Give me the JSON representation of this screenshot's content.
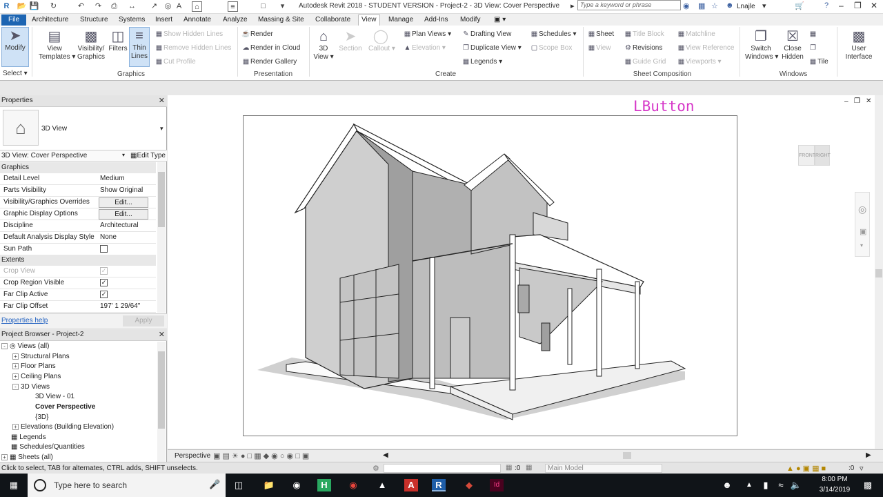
{
  "window": {
    "app_title": "Autodesk Revit 2018 -  STUDENT VERSION -    Project-2 - 3D View: Cover Perspective",
    "search_placeholder": "Type a keyword or phrase",
    "username": "Lnajle"
  },
  "menu_tabs": [
    "File",
    "Architecture",
    "Structure",
    "Systems",
    "Insert",
    "Annotate",
    "Analyze",
    "Massing & Site",
    "Collaborate",
    "View",
    "Manage",
    "Add-Ins",
    "Modify"
  ],
  "active_tab": "View",
  "ribbon": {
    "select": {
      "modify": "Modify",
      "select": "Select"
    },
    "graphics": {
      "label": "Graphics",
      "view_templates": [
        "View",
        "Templates"
      ],
      "visibility": [
        "Visibility/",
        "Graphics"
      ],
      "filters": "Filters",
      "thin_lines": [
        "Thin",
        "Lines"
      ],
      "show_hidden": "Show  Hidden Lines",
      "remove_hidden": "Remove  Hidden Lines",
      "cut_profile": "Cut  Profile"
    },
    "presentation": {
      "label": "Presentation",
      "render": "Render",
      "render_cloud": "Render  in Cloud",
      "render_gallery": "Render  Gallery"
    },
    "create": {
      "label": "Create",
      "view3d": [
        "3D",
        "View"
      ],
      "section": "Section",
      "callout": "Callout",
      "plan_views": "Plan  Views",
      "elevation": "Elevation",
      "drafting_view": "Drafting  View",
      "duplicate_view": "Duplicate  View",
      "legends": "Legends",
      "schedules": "Schedules",
      "scope_box": "Scope  Box"
    },
    "sheet_composition": {
      "label": "Sheet Composition",
      "sheet": "Sheet",
      "view": "View",
      "title_block": "Title  Block",
      "revisions": "Revisions",
      "guide_grid": "Guide  Grid",
      "matchline": "Matchline",
      "view_reference": "View  Reference",
      "viewports": "Viewports"
    },
    "windows": {
      "label": "Windows",
      "switch": [
        "Switch",
        "Windows"
      ],
      "close_hidden": [
        "Close",
        "Hidden"
      ],
      "tile": "Tile"
    },
    "user_interface": [
      "User",
      "Interface"
    ]
  },
  "properties": {
    "title": "Properties",
    "type_name": "3D View",
    "instance": "3D View: Cover Perspective",
    "edit_type": "Edit Type",
    "group_graphics": "Graphics",
    "group_extents": "Extents",
    "rows": [
      {
        "k": "Detail Level",
        "v": "Medium"
      },
      {
        "k": "Parts Visibility",
        "v": "Show Original"
      },
      {
        "k": "Visibility/Graphics Overrides",
        "v": "Edit..."
      },
      {
        "k": "Graphic Display Options",
        "v": "Edit..."
      },
      {
        "k": "Discipline",
        "v": "Architectural"
      },
      {
        "k": "Default Analysis Display Style",
        "v": "None"
      },
      {
        "k": "Sun Path",
        "v": ""
      },
      {
        "k": "Crop View",
        "v": ""
      },
      {
        "k": "Crop Region Visible",
        "v": ""
      },
      {
        "k": "Far Clip Active",
        "v": ""
      },
      {
        "k": "Far Clip Offset",
        "v": "197'  1 29/64\""
      }
    ],
    "help": "Properties help",
    "apply": "Apply"
  },
  "browser": {
    "title": "Project Browser - Project-2",
    "items": [
      {
        "label": "Views (all)",
        "level": 0,
        "pm": "-"
      },
      {
        "label": "Structural Plans",
        "level": 1,
        "pm": "+"
      },
      {
        "label": "Floor Plans",
        "level": 1,
        "pm": "+"
      },
      {
        "label": "Ceiling Plans",
        "level": 1,
        "pm": "+"
      },
      {
        "label": "3D Views",
        "level": 1,
        "pm": "-"
      },
      {
        "label": "3D View - 01",
        "level": 2,
        "pm": ""
      },
      {
        "label": "Cover Perspective",
        "level": 2,
        "pm": "",
        "bold": true
      },
      {
        "label": "{3D}",
        "level": 2,
        "pm": ""
      },
      {
        "label": "Elevations (Building Elevation)",
        "level": 1,
        "pm": "+"
      },
      {
        "label": "Legends",
        "level": 0,
        "pm": ""
      },
      {
        "label": "Schedules/Quantities",
        "level": 0,
        "pm": ""
      },
      {
        "label": "Sheets (all)",
        "level": 0,
        "pm": "+"
      }
    ]
  },
  "canvas": {
    "overlay_text": "LButton",
    "viewcube_front": "FRONT",
    "viewcube_right": "RIGHT"
  },
  "viewbar": {
    "mode": "Perspective"
  },
  "status": {
    "hint": "Click to select, TAB for alternates, CTRL adds, SHIFT unselects.",
    "count": ":0",
    "model": "Main Model"
  },
  "taskbar": {
    "search": "Type here to search",
    "time": "8:00 PM",
    "date": "3/14/2019"
  }
}
